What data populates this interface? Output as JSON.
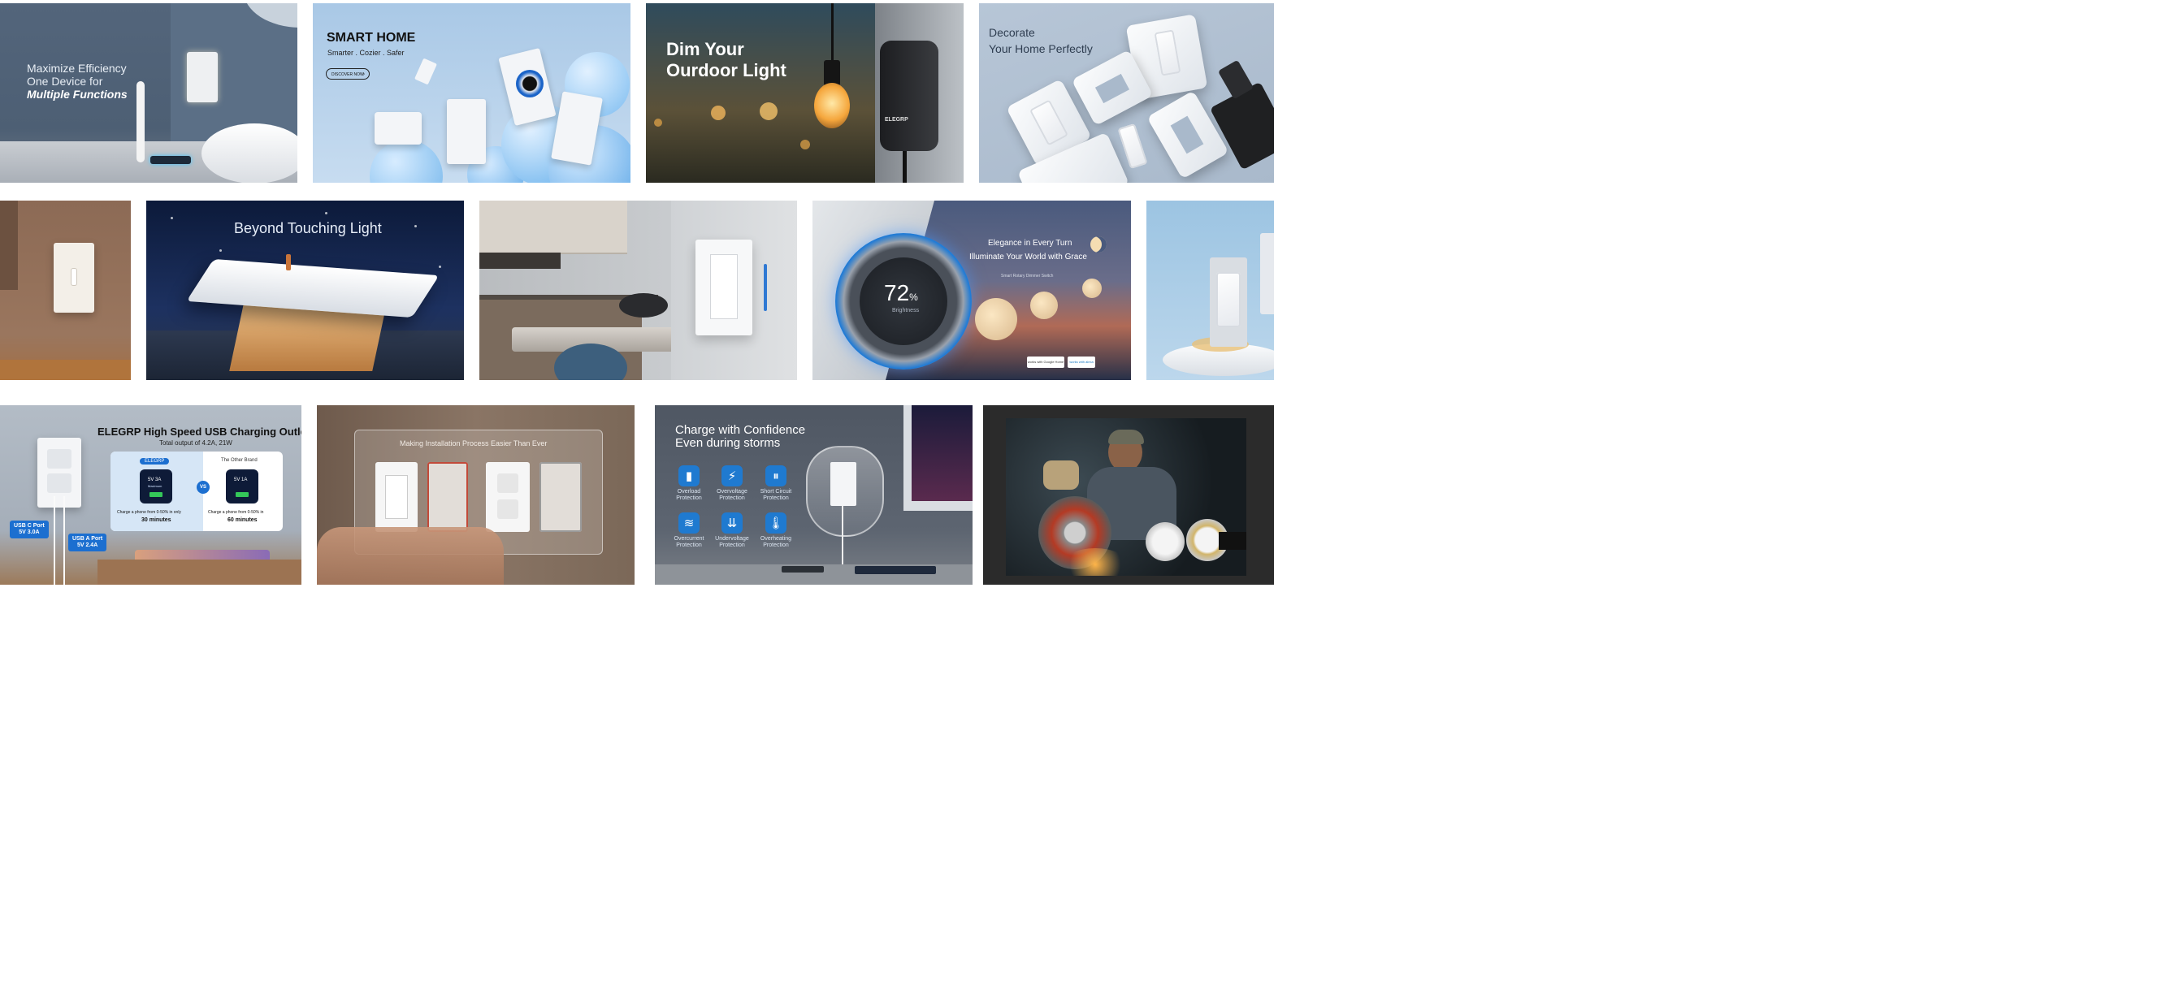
{
  "tiles": {
    "t1": {
      "line1": "Maximize Efficiency",
      "line2": "One Device for",
      "line3": "Multiple Functions"
    },
    "t2": {
      "title": "SMART HOME",
      "subtitle": "Smarter . Cozier . Safer",
      "button": "DISCOVER NOW",
      "button_icon": "chevron-right"
    },
    "t3": {
      "line1": "Dim Your",
      "line2": "Ourdoor Light",
      "brand": "ELEGRP"
    },
    "t4": {
      "line1": "Decorate",
      "line2": "Your Home Perfectly"
    },
    "t6": {
      "title": "Beyond Touching Light"
    },
    "t8": {
      "line1": "Elegance in Every Turn",
      "line2": "Illuminate Your World with Grace",
      "caption": "Smart Rotary Dimmer Switch",
      "dial_value": "72",
      "dial_unit": "%",
      "dial_label": "Brightness",
      "badge1": "works with Google Home",
      "badge2": "works with alexa"
    },
    "t10": {
      "title": "ELEGRP High Speed USB Charging Outlet",
      "subtitle": "Total output of 4.2A, 21W",
      "left_brand": "ELEGRP",
      "left_spec1": "5V 3A",
      "left_spec2": "Maximum",
      "left_desc": "Charge a phone from 0-50% in only",
      "left_time": "30 minutes",
      "vs": "VS",
      "right_brand": "The Other Brand",
      "right_spec1": "5V 1A",
      "right_desc": "Charge a phone from 0-50% in",
      "right_time": "60 minutes",
      "usbc_label1": "USB C Port",
      "usbc_label2": "5V 3.0A",
      "usba_label1": "USB A Port",
      "usba_label2": "5V 2.4A"
    },
    "t11": {
      "title": "Making Installation Process Easier Than Ever"
    },
    "t12": {
      "line1": "Charge with Confidence",
      "line2": "Even during storms",
      "features": [
        {
          "icon": "battery-icon",
          "glyph": "▮",
          "line1": "Overload",
          "line2": "Protection"
        },
        {
          "icon": "lightning-icon",
          "glyph": "⚡",
          "line1": "Overvoltage",
          "line2": "Protection"
        },
        {
          "icon": "circuit-icon",
          "glyph": "⏸",
          "line1": "Short Circuit",
          "line2": "Protection"
        },
        {
          "icon": "wave-icon",
          "glyph": "≋",
          "line1": "Overcurrent",
          "line2": "Protection"
        },
        {
          "icon": "down-arrows-icon",
          "glyph": "⇊",
          "line1": "Undervoltage",
          "line2": "Protection"
        },
        {
          "icon": "thermometer-icon",
          "glyph": "🌡",
          "line1": "Overheating",
          "line2": "Protection"
        }
      ]
    }
  },
  "colors": {
    "brand_blue": "#1c6fd0",
    "sky": "#b9d4ee",
    "night": "#14203d"
  }
}
